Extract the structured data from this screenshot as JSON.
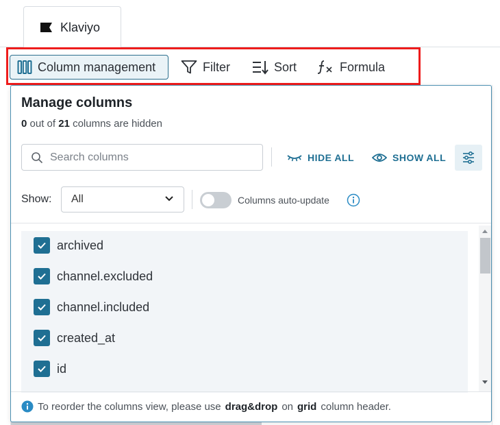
{
  "tabs": [
    {
      "label": "Klaviyo",
      "icon": "flag-icon"
    }
  ],
  "toolbar": {
    "column_management_label": "Column management",
    "filter_label": "Filter",
    "sort_label": "Sort",
    "formula_label": "Formula"
  },
  "panel": {
    "title": "Manage columns",
    "hidden_count": "0",
    "hidden_mid": "out of",
    "total_count": "21",
    "hidden_suffix": "columns are hidden",
    "search_placeholder": "Search columns",
    "hide_all_label": "HIDE ALL",
    "show_all_label": "SHOW ALL",
    "show_label": "Show:",
    "show_selected": "All",
    "auto_update_label": "Columns auto-update",
    "auto_update_on": false,
    "columns": [
      {
        "name": "archived",
        "checked": true
      },
      {
        "name": "channel.excluded",
        "checked": true
      },
      {
        "name": "channel.included",
        "checked": true
      },
      {
        "name": "created_at",
        "checked": true
      },
      {
        "name": "id",
        "checked": true
      }
    ],
    "footer": {
      "prefix": "To reorder the columns view, please use",
      "bold1": "drag&drop",
      "mid": "on",
      "bold2": "grid",
      "suffix": "column header."
    }
  },
  "colors": {
    "accent": "#1f6f93",
    "highlight": "#ee1c1c"
  }
}
